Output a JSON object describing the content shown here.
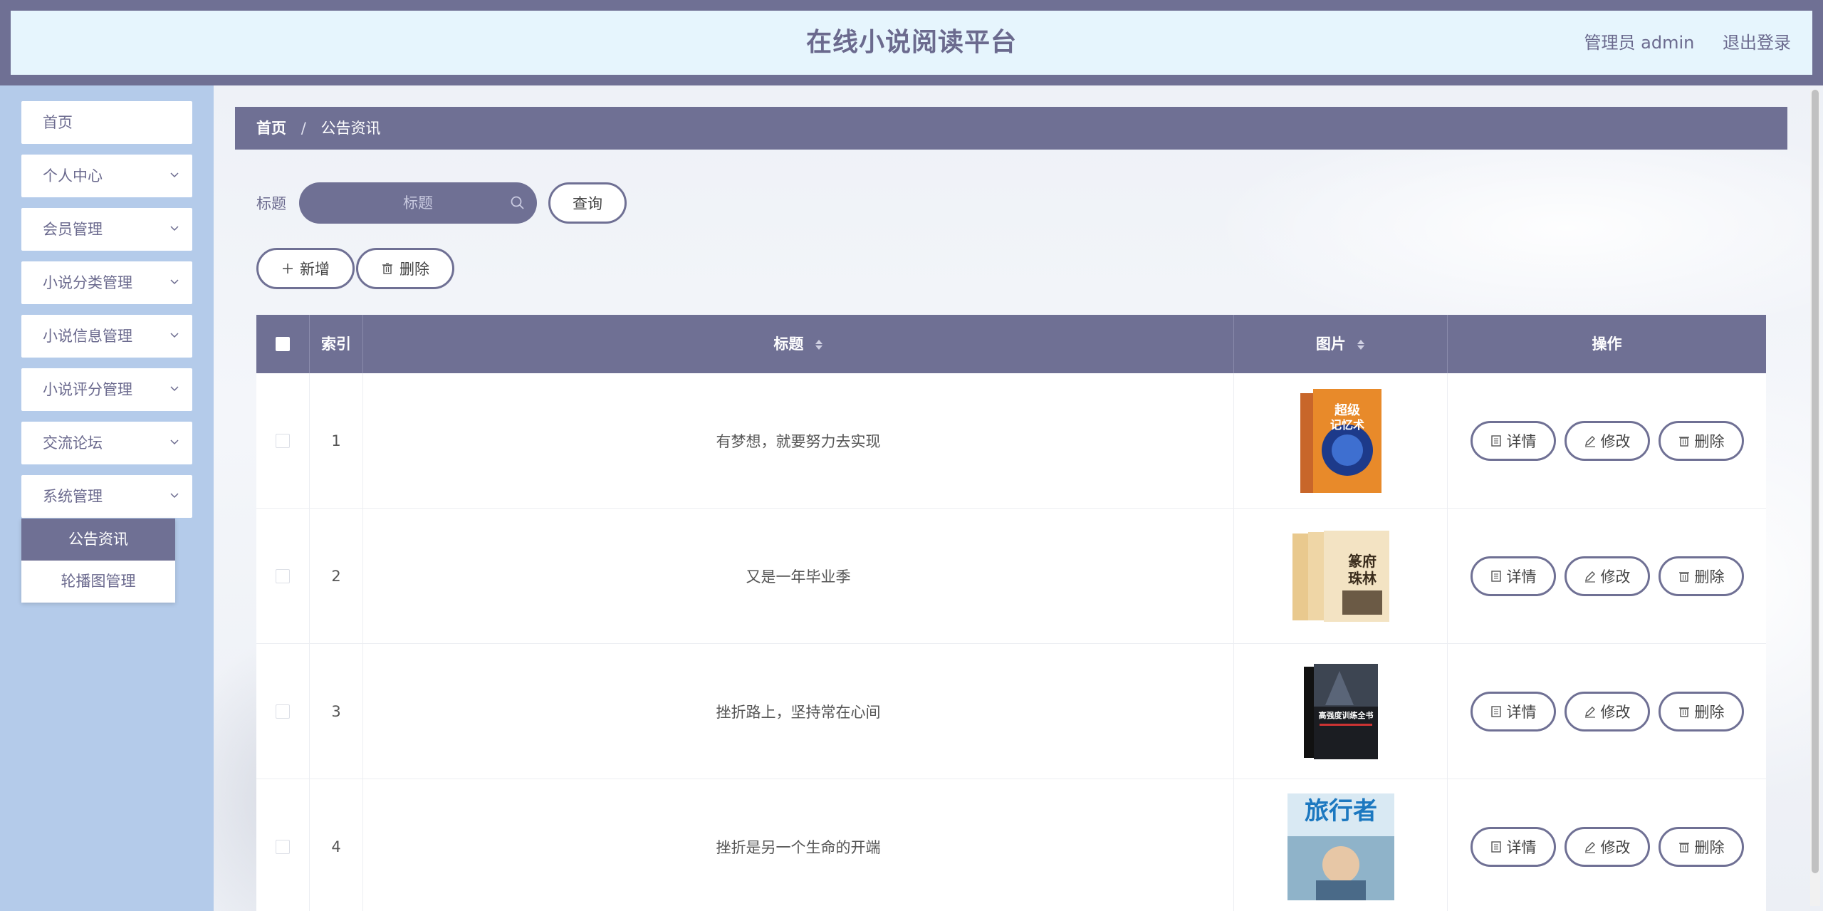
{
  "header": {
    "title": "在线小说阅读平台",
    "user": "管理员 admin",
    "logout": "退出登录"
  },
  "sidebar": {
    "items": [
      {
        "label": "首页",
        "expandable": false
      },
      {
        "label": "个人中心",
        "expandable": true
      },
      {
        "label": "会员管理",
        "expandable": true
      },
      {
        "label": "小说分类管理",
        "expandable": true
      },
      {
        "label": "小说信息管理",
        "expandable": true
      },
      {
        "label": "小说评分管理",
        "expandable": true
      },
      {
        "label": "交流论坛",
        "expandable": true
      },
      {
        "label": "系统管理",
        "expandable": true
      }
    ],
    "submenu": [
      {
        "label": "公告资讯",
        "active": true
      },
      {
        "label": "轮播图管理",
        "active": false
      }
    ]
  },
  "breadcrumb": {
    "home": "首页",
    "separator": "/",
    "current": "公告资讯"
  },
  "search": {
    "label": "标题",
    "placeholder": "标题",
    "button": "查询"
  },
  "toolbar": {
    "add": "新增",
    "delete": "删除"
  },
  "table": {
    "columns": [
      "",
      "索引",
      "标题",
      "图片",
      "操作"
    ],
    "rows": [
      {
        "index": "1",
        "title": "有梦想，就要努力去实现",
        "book": "超级记忆术"
      },
      {
        "index": "2",
        "title": "又是一年毕业季",
        "book": "篆府珠林"
      },
      {
        "index": "3",
        "title": "挫折路上，坚持常在心间",
        "book": "高强度训练全书"
      },
      {
        "index": "4",
        "title": "挫折是另一个生命的开端",
        "book": "旅行者"
      }
    ],
    "actions": {
      "detail": "详情",
      "edit": "修改",
      "delete": "删除"
    }
  },
  "colors": {
    "primary": "#6f7094",
    "sidebar_bg": "#b4cbea",
    "header_bg": "#e6f5fd"
  }
}
